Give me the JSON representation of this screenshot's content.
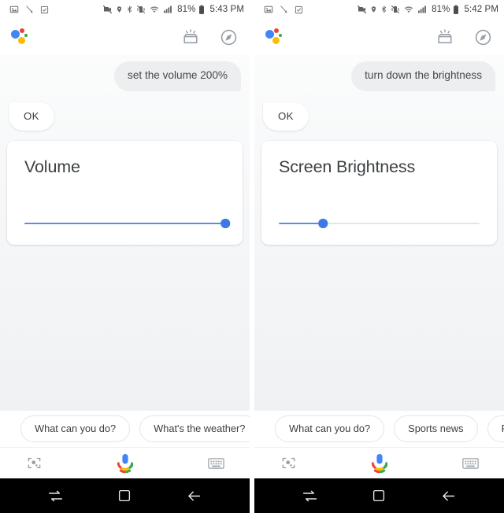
{
  "panels": [
    {
      "id": "left",
      "statusbar": {
        "left_icons": [
          "image-icon",
          "no-sim-icon",
          "checkbox-icon"
        ],
        "right_icons": [
          "mute-camera-icon",
          "location-icon",
          "bluetooth-icon",
          "vibrate-icon",
          "wifi-icon",
          "signal-icon"
        ],
        "battery_percent": "81%",
        "battery_icon": "battery-icon",
        "time": "5:43 PM"
      },
      "header": {
        "logo": "google-assistant-logo",
        "snapshot_icon": "snapshot-icon",
        "explore_icon": "explore-compass-icon"
      },
      "conversation": {
        "user_message": "set the volume 200%",
        "assistant_message": "OK"
      },
      "card": {
        "title": "Volume",
        "slider_name": "volume-slider",
        "slider_value": 100,
        "slider_min": 0,
        "slider_max": 100
      },
      "chips": [
        "What can you do?",
        "What's the weather?",
        ""
      ],
      "toolbar": {
        "lens_icon": "google-lens-icon",
        "mic_icon": "microphone-icon",
        "keyboard_icon": "keyboard-icon"
      },
      "navbar": {
        "recents_icon": "recents-icon",
        "home_icon": "home-icon",
        "back_icon": "back-icon"
      }
    },
    {
      "id": "right",
      "statusbar": {
        "left_icons": [
          "image-icon",
          "no-sim-icon",
          "checkbox-icon"
        ],
        "right_icons": [
          "mute-camera-icon",
          "location-icon",
          "bluetooth-icon",
          "vibrate-icon",
          "wifi-icon",
          "signal-icon"
        ],
        "battery_percent": "81%",
        "battery_icon": "battery-icon",
        "time": "5:42 PM"
      },
      "header": {
        "logo": "google-assistant-logo",
        "snapshot_icon": "snapshot-icon",
        "explore_icon": "explore-compass-icon"
      },
      "conversation": {
        "user_message": "turn down the brightness",
        "assistant_message": "OK"
      },
      "card": {
        "title": "Screen Brightness",
        "slider_name": "brightness-slider",
        "slider_value": 22,
        "slider_min": 0,
        "slider_max": 100
      },
      "chips": [
        "What can you do?",
        "Sports news",
        "Play so"
      ],
      "toolbar": {
        "lens_icon": "google-lens-icon",
        "mic_icon": "microphone-icon",
        "keyboard_icon": "keyboard-icon"
      },
      "navbar": {
        "recents_icon": "recents-icon",
        "home_icon": "home-icon",
        "back_icon": "back-icon"
      }
    }
  ],
  "colors": {
    "accent_blue": "#3b7ae4",
    "track_blue": "#5b8de4",
    "track_gray": "#e4e6e8",
    "bubble_gray": "#eceef0",
    "text_primary": "#3c4043",
    "logo_blue": "#4285f4",
    "logo_red": "#ea4335",
    "logo_yellow": "#fbbc05",
    "logo_green": "#34a853",
    "navbar_bg": "#000000"
  }
}
